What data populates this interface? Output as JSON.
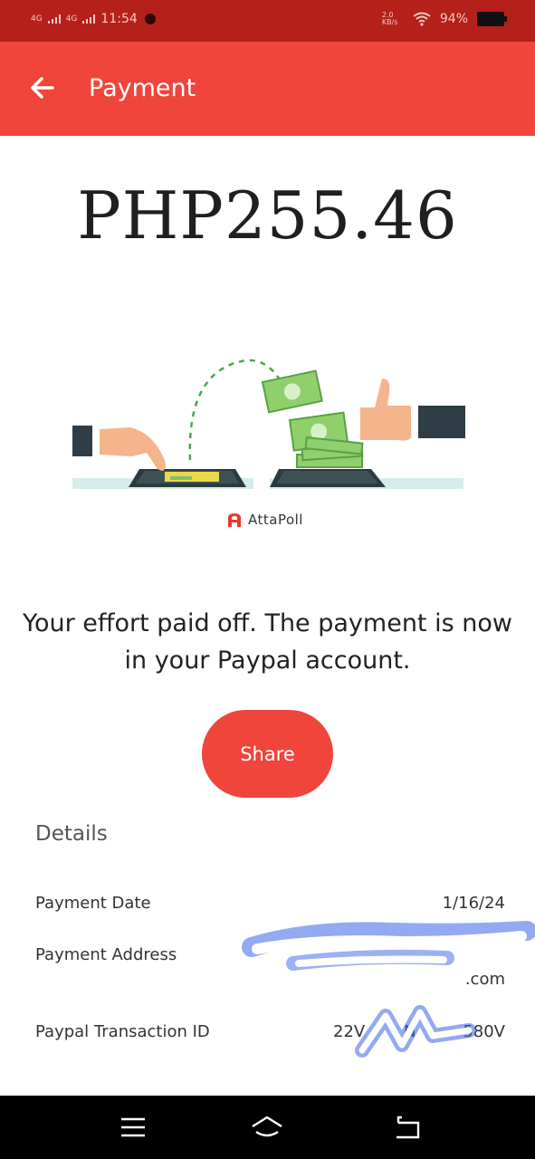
{
  "status_bar": {
    "signal_1": "4G",
    "signal_2": "4G",
    "time": "11:54",
    "speed": "2.0 KB/s",
    "battery": "94%"
  },
  "app_bar": {
    "title": "Payment",
    "back_icon": "arrow-left-icon"
  },
  "amount": "PHP255.46",
  "brand": "AttaPoll",
  "message": "Your effort paid off. The payment is now in your Paypal account.",
  "share_button": "Share",
  "details": {
    "title": "Details",
    "payment_date_label": "Payment Date",
    "payment_date_value": "1/16/24",
    "payment_address_label": "Payment Address",
    "payment_address_value": ".com",
    "transaction_id_label": "Paypal Transaction ID",
    "transaction_id_prefix": "22V",
    "transaction_id_middle": "N",
    "transaction_id_suffix": "580V"
  },
  "nav": {
    "menu_icon": "menu-icon",
    "home_icon": "home-icon",
    "back_icon": "back-icon"
  },
  "colors": {
    "status_bar": "#b5201a",
    "app_bar": "#f0453a",
    "accent": "#f0453a"
  }
}
